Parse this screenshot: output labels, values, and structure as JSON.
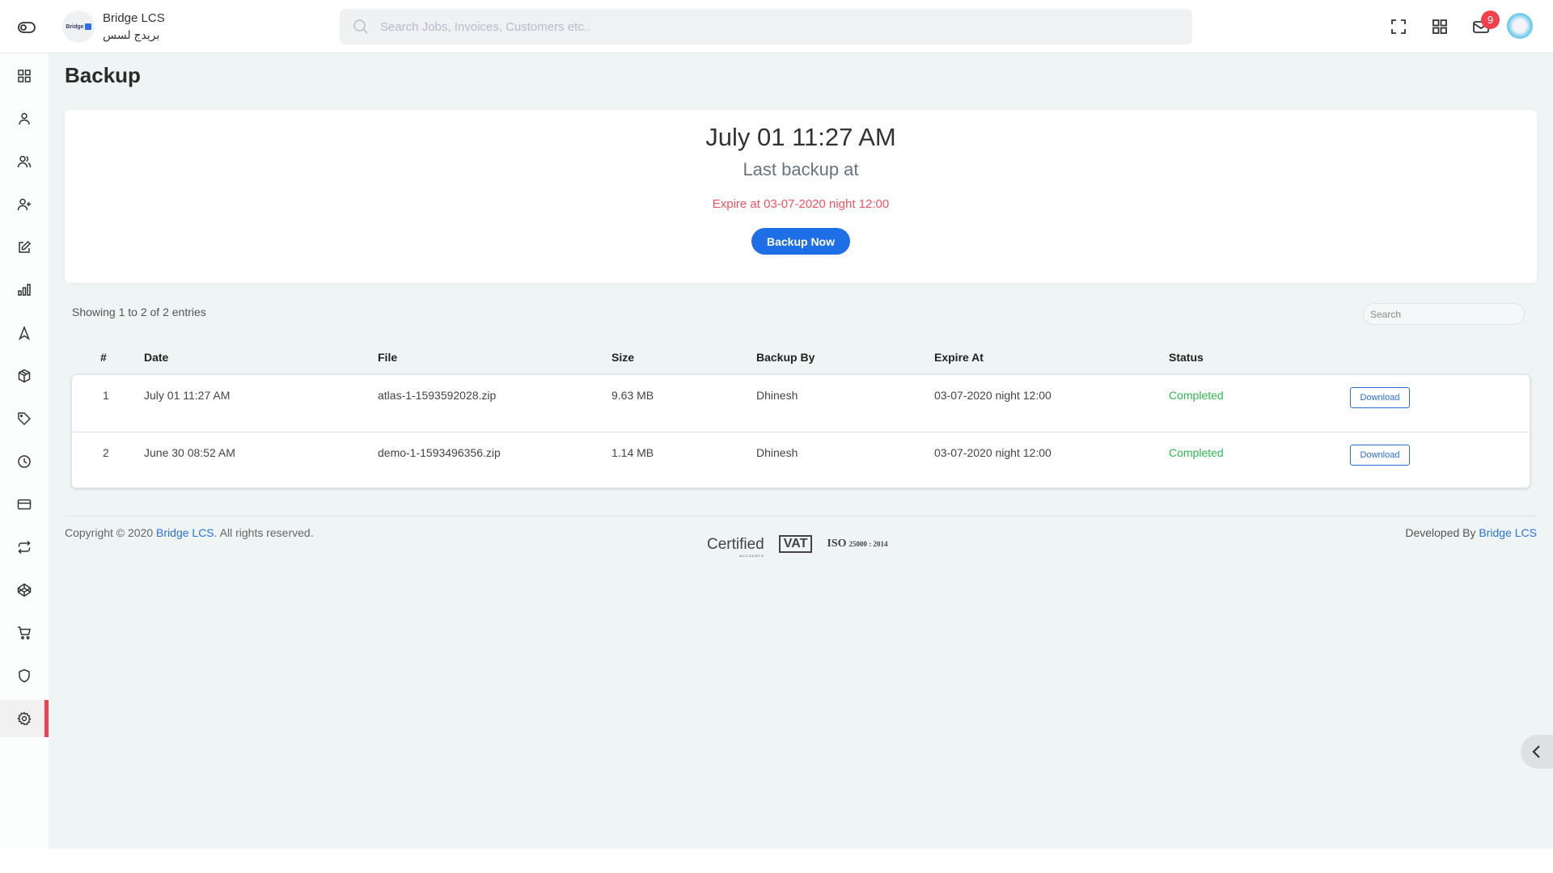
{
  "header": {
    "brand_name": "Bridge LCS",
    "brand_subtitle": "بريدج لسس",
    "logo_text": "Bridge",
    "search_placeholder": "Search Jobs, Invoices, Customers etc..",
    "notification_count": "9",
    "icons": [
      "sidebar-toggle-icon",
      "fullscreen-icon",
      "apps-grid-icon",
      "mail-icon",
      "user-avatar"
    ]
  },
  "sidebar": {
    "items": [
      {
        "name": "dashboard",
        "icon": "grid-icon"
      },
      {
        "name": "user",
        "icon": "user-icon"
      },
      {
        "name": "users",
        "icon": "users-icon"
      },
      {
        "name": "add-user",
        "icon": "user-plus-icon"
      },
      {
        "name": "edit",
        "icon": "edit-icon"
      },
      {
        "name": "reports",
        "icon": "bar-chart-icon"
      },
      {
        "name": "navigation",
        "icon": "navigation-icon"
      },
      {
        "name": "package",
        "icon": "package-icon"
      },
      {
        "name": "tags",
        "icon": "tag-icon"
      },
      {
        "name": "history",
        "icon": "clock-icon"
      },
      {
        "name": "payments",
        "icon": "credit-card-icon"
      },
      {
        "name": "transfers",
        "icon": "repeat-icon"
      },
      {
        "name": "codepen",
        "icon": "codepen-icon"
      },
      {
        "name": "cart",
        "icon": "cart-icon"
      },
      {
        "name": "security",
        "icon": "shield-icon"
      },
      {
        "name": "settings",
        "icon": "gear-icon",
        "active": true
      }
    ],
    "active_color": "#f1414d"
  },
  "page": {
    "title": "Backup"
  },
  "backup_card": {
    "last_backup_time": "July 01 11:27 AM",
    "last_backup_label": "Last backup at",
    "expire_text": "Expire at 03-07-2020 night 12:00",
    "backup_now_label": "Backup Now",
    "button_color": "#1e6fe6",
    "expire_color": "#f1535f"
  },
  "table": {
    "entries_info": "Showing 1 to 2 of 2 entries",
    "search_placeholder": "Search",
    "columns": [
      "#",
      "Date",
      "File",
      "Size",
      "Backup By",
      "Expire At",
      "Status",
      ""
    ],
    "rows": [
      {
        "num": "1",
        "date": "July 01 11:27 AM",
        "file": "atlas-1-1593592028.zip",
        "size": "9.63 MB",
        "backup_by": "Dhinesh",
        "expire_at": "03-07-2020 night 12:00",
        "status": "Completed",
        "action": "Download"
      },
      {
        "num": "2",
        "date": "June 30 08:52 AM",
        "file": "demo-1-1593496356.zip",
        "size": "1.14 MB",
        "backup_by": "Dhinesh",
        "expire_at": "03-07-2020 night 12:00",
        "status": "Completed",
        "action": "Download"
      }
    ],
    "status_color": "#2db84d"
  },
  "footer": {
    "copyright_prefix": "Copyright © 2020 ",
    "copyright_link": "Bridge LCS",
    "copyright_suffix": ". All rights reserved.",
    "developed_prefix": "Developed By ",
    "developed_link": "Bridge LCS",
    "logos": {
      "certified": "Certified",
      "certified_sub": "ACCOUNTS",
      "vat": "VAT",
      "iso": "ISO",
      "iso_detail": "25000 : 2014"
    }
  }
}
